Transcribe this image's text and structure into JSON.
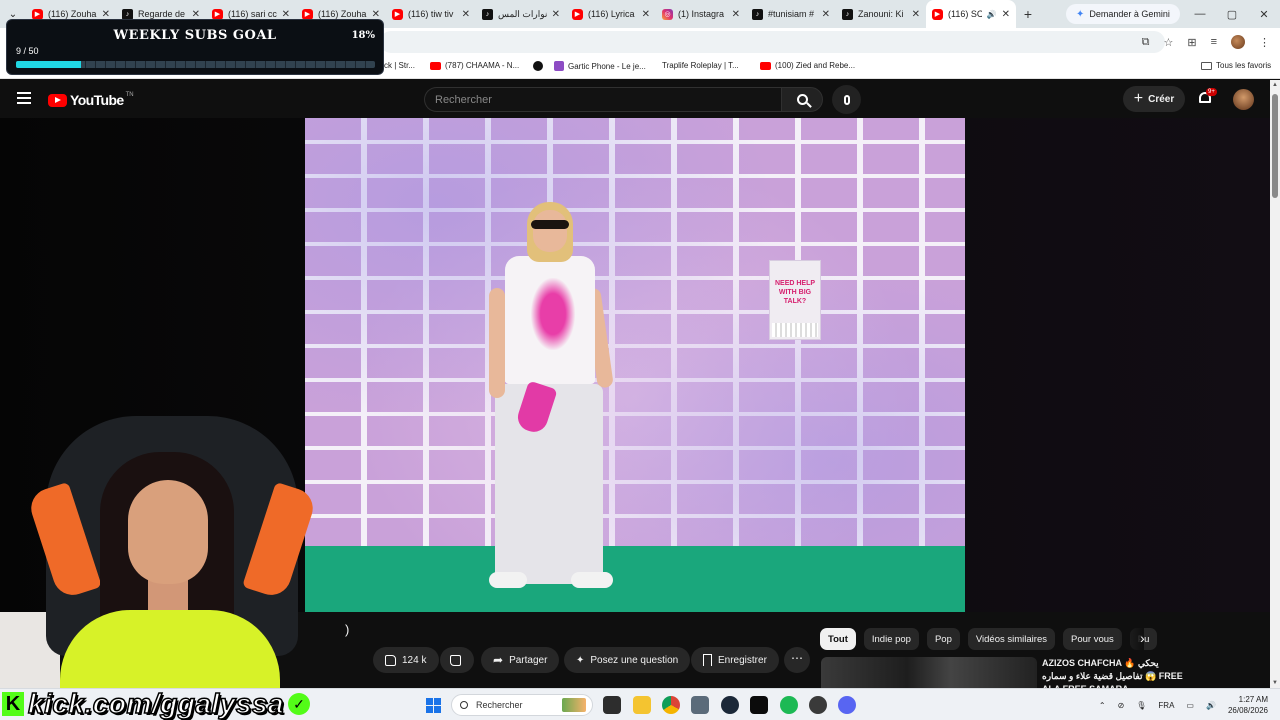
{
  "browser": {
    "tabs": [
      {
        "label": "(116) Zouha",
        "favicon": "youtube-icon"
      },
      {
        "label": "Regarde de",
        "favicon": "tiktok-icon"
      },
      {
        "label": "(116) sari cc",
        "favicon": "youtube-icon"
      },
      {
        "label": "(116) Zouha",
        "favicon": "youtube-icon"
      },
      {
        "label": "(116) tiw tiv",
        "favicon": "youtube-icon"
      },
      {
        "label": "نوارات المس",
        "favicon": "tiktok-icon"
      },
      {
        "label": "(116) Lyrica",
        "favicon": "youtube-icon"
      },
      {
        "label": "(1) Instagra",
        "favicon": "instagram-icon"
      },
      {
        "label": "#tunisiam #",
        "favicon": "tiktok-icon"
      },
      {
        "label": "Zanouni: Ki",
        "favicon": "tiktok-icon"
      },
      {
        "label": "(116) SC",
        "favicon": "youtube-icon",
        "active": true
      }
    ],
    "gemini_button": "Demander à Gemini",
    "bookmarks": [
      {
        "label": "ck | Str..."
      },
      {
        "label": "(787) CHAAMA - N..."
      },
      {
        "label": ""
      },
      {
        "label": "Gartic Phone - Le je..."
      },
      {
        "label": "Traplife Roleplay | T..."
      },
      {
        "label": "(100) Zied and Rebe..."
      }
    ],
    "all_bookmarks": "Tous les favoris"
  },
  "overlay": {
    "goal_title": "WEEKLY SUBS GOAL",
    "goal_count": "9 / 50",
    "goal_percent": "18%",
    "goal_progress": 0.18,
    "kick_url": "kick.com/ggalyssa",
    "kick_letter": "K"
  },
  "youtube": {
    "logo_text": "YouTube",
    "logo_sup": "TN",
    "search_placeholder": "Rechercher",
    "create_label": "Créer",
    "notif_badge": "9+",
    "poster_text": "NEED HELP WITH BIG TALK?",
    "video_title_fragment": ")",
    "actions": {
      "likes": "124 k",
      "share": "Partager",
      "ask": "Posez une question",
      "save": "Enregistrer"
    },
    "chips": [
      "Tout",
      "Indie pop",
      "Pop",
      "Vidéos similaires",
      "Pour vous",
      "Pu"
    ],
    "recommendation": {
      "title_line1": "AZIZOS CHAFCHA 🔥 يحكي",
      "title_line2": "تفاصيل قضية علاء و سماره 😱 FREE",
      "title_line3": "ALA FREE SAMARA"
    }
  },
  "taskbar": {
    "search_placeholder": "Rechercher",
    "language": "FRA",
    "time": "1:27 AM",
    "date": "26/08/2026"
  },
  "colors": {
    "youtube_red": "#ff0000",
    "kick_green": "#53fc18",
    "goal_fill": "#20d7e4"
  }
}
